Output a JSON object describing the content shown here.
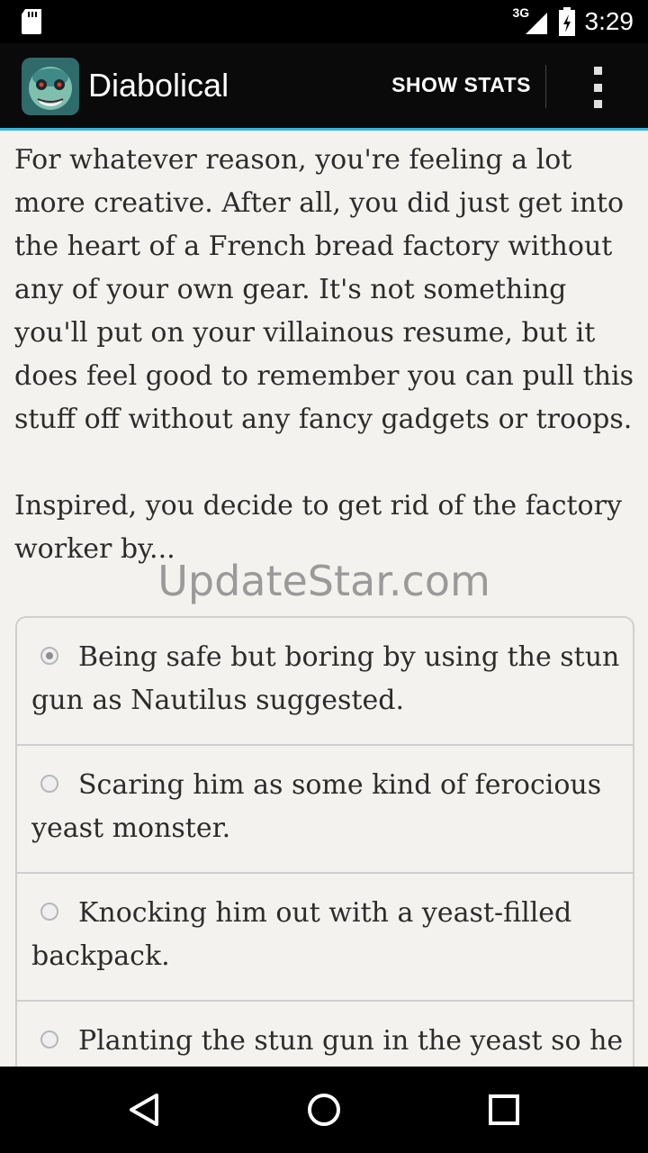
{
  "status_bar": {
    "time": "3:29",
    "network_type": "3G",
    "icons": [
      "sd-card-icon",
      "signal-icon",
      "battery-icon"
    ]
  },
  "app_bar": {
    "title": "Diabolical",
    "action_label": "SHOW STATS",
    "accent_color": "#33b5e5"
  },
  "passage": {
    "paragraphs": [
      "For whatever reason, you're feeling a lot more creative. After all, you did just get into the heart of a French bread factory without any of your own gear. It's not something you'll put on your villainous resume, but it does feel good to remember you can pull this stuff off without any fancy gadgets or troops.",
      "Inspired, you decide to get rid of the factory worker by..."
    ]
  },
  "watermark": "UpdateStar.com",
  "choices": [
    {
      "label": "Being safe but boring by using the stun gun as Nautilus suggested.",
      "selected": true
    },
    {
      "label": "Scaring him as some kind of ferocious yeast monster.",
      "selected": false
    },
    {
      "label": "Knocking him out with a yeast-filled backpack.",
      "selected": false
    },
    {
      "label": "Planting the stun gun in the yeast so he",
      "selected": false
    }
  ],
  "nav_bar": {
    "buttons": [
      "back-icon",
      "home-icon",
      "recents-icon"
    ]
  }
}
